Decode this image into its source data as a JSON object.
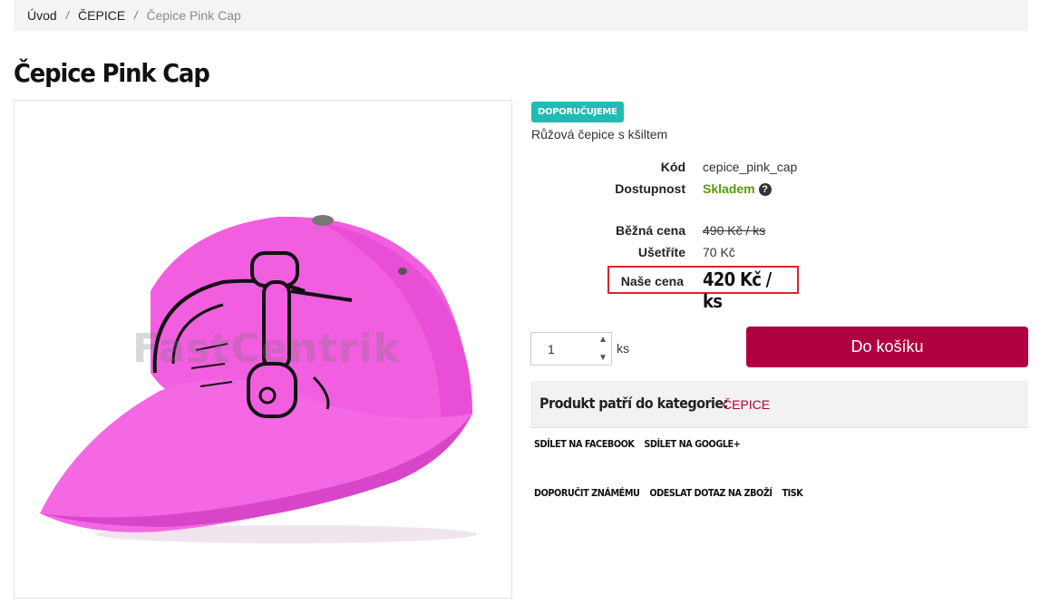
{
  "breadcrumb": {
    "items": [
      "Úvod",
      "ČEPICE"
    ],
    "separator": "/",
    "current": "Čepice Pink Cap"
  },
  "product": {
    "title": "Čepice Pink Cap",
    "badge": "DOPORUČUJEME",
    "short_description": "Růžová čepice s kšiltem",
    "watermark": "FastCentrik",
    "params": {
      "code_label": "Kód",
      "code_value": "cepice_pink_cap",
      "availability_label": "Dostupnost",
      "availability_value": "Skladem",
      "availability_help_icon": "question-circle-icon",
      "regular_price_label": "Běžná cena",
      "regular_price_value": "490 Kč / ks",
      "savings_label": "Ušetříte",
      "savings_value": "70 Kč",
      "our_price_label": "Naše cena",
      "our_price_value": "420 Kč / ks"
    },
    "quantity": {
      "value": "1",
      "unit": "ks"
    },
    "add_to_cart_label": "Do košíku",
    "category": {
      "label": "Produkt patří do kategorie:",
      "link": "ČEPICE"
    },
    "share_links": [
      "SDÍLET NA FACEBOOK",
      "SDÍLET NA GOOGLE+"
    ],
    "action_links": [
      "DOPORUČIT ZNÁMÉMU",
      "ODESLAT DOTAZ NA ZBOŽÍ",
      "TISK"
    ]
  },
  "colors": {
    "badge": "#1fbbb4",
    "accent": "#b0003f",
    "availability": "#5a9a0a",
    "price_box_border": "#d9262c",
    "cap": "#f25ee0"
  }
}
